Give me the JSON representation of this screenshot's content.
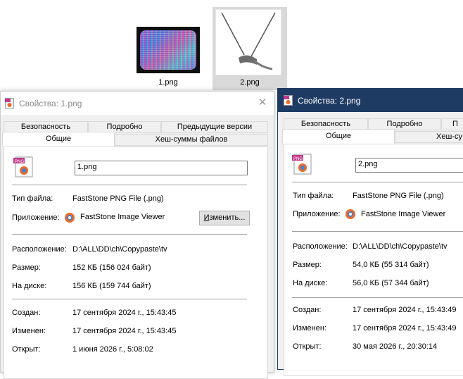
{
  "explorer": {
    "files": [
      {
        "name": "1.png",
        "selected": false
      },
      {
        "name": "2.png",
        "selected": true
      }
    ]
  },
  "dialog1": {
    "title": "Свойства: 1.png",
    "close_icon": "✕",
    "tabs_back": [
      "Безопасность",
      "Подробно",
      "Предыдущие версии"
    ],
    "tabs_front": [
      "Общие",
      "Хеш-суммы файлов"
    ],
    "file_name": "1.png",
    "labels": {
      "type": "Тип файла:",
      "app": "Приложение:",
      "location": "Расположение:",
      "size": "Размер:",
      "on_disk": "На диске:",
      "created": "Создан:",
      "modified": "Изменен:",
      "opened": "Открыт:"
    },
    "values": {
      "type": "FastStone PNG File (.png)",
      "app": "FastStone Image Viewer",
      "location": "D:\\ALL\\DD\\ch\\Copypaste\\tv",
      "size": "152 КБ (156 024 байт)",
      "on_disk": "156 КБ (159 744 байт)",
      "created": "17 сентября 2024 г., 15:43:45",
      "modified": "17 сентября 2024 г., 15:43:45",
      "opened": "1 июня 2026 г., 5:08:02"
    },
    "change_button": "Изменить..."
  },
  "dialog2": {
    "title": "Свойства: 2.png",
    "tabs_back": [
      "Безопасность",
      "Подробно",
      "П"
    ],
    "tabs_front": [
      "Общие",
      "Хеш-су"
    ],
    "file_name": "2.png",
    "labels": {
      "type": "Тип файла:",
      "app": "Приложение:",
      "location": "Расположение:",
      "size": "Размер:",
      "on_disk": "На диске:",
      "created": "Создан:",
      "modified": "Изменен:",
      "opened": "Открыт:"
    },
    "values": {
      "type": "FastStone PNG File (.png)",
      "app": "FastStone Image Viewer",
      "location": "D:\\ALL\\DD\\ch\\Copypaste\\tv",
      "size": "54,0 КБ (55 314 байт)",
      "on_disk": "56,0 КБ (57 344 байт)",
      "created": "17 сентября 2024 г., 15:43:49",
      "modified": "17 сентября 2024 г., 15:43:49",
      "opened": "30 мая 2026 г., 20:30:14"
    }
  },
  "icons": {
    "png_badge": "PNG",
    "file_icon": "png-file-icon",
    "app_icon": "faststone-app-icon"
  },
  "colors": {
    "active_title": "#1e3b63",
    "selected_item": "#d9d9d9"
  }
}
